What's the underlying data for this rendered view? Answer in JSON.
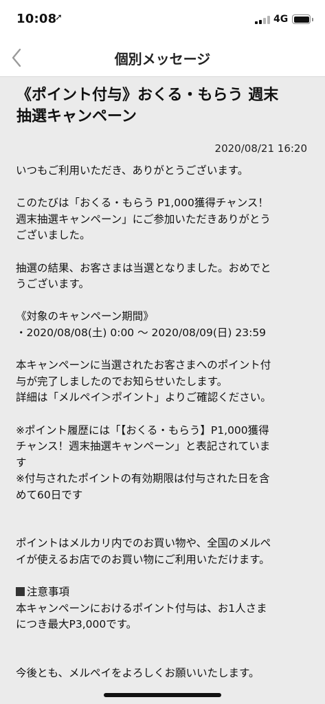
{
  "status_bar": {
    "time": "10:08",
    "location_arrow": "➚",
    "network": "4G",
    "signal_bars_active": 2,
    "signal_bars_total": 4,
    "battery_level": 1.0
  },
  "nav": {
    "title": "個別メッセージ",
    "back_icon": "chevron-left-icon"
  },
  "message": {
    "title_line1": "《ポイント付与》おくる・もらう 週末",
    "title_line2": "抽選キャンペーン",
    "date": "2020/08/21 16:20",
    "lines": {
      "l1": "いつもご利用いただき、ありがとうございます。",
      "l2": "このたびは「おくる・もらう P1,000獲得チャンス！",
      "l3": "週末抽選キャンペーン」にご参加いただきありがとう",
      "l4": "ございました。",
      "l5": "抽選の結果、お客さまは当選となりました。おめでと",
      "l6": "うございます。",
      "l7": "《対象のキャンペーン期間》",
      "l8": "・2020/08/08(土) 0:00 〜 2020/08/09(日) 23:59",
      "l9": "本キャンペーンに当選されたお客さまへのポイント付",
      "l10": "与が完了しましたのでお知らせいたします。",
      "l11": "詳細は「メルペイ＞ポイント」よりご確認ください。",
      "l12": "※ポイント履歴には「【おくる・もらう】P1,000獲得",
      "l13": "チャンス！週末抽選キャンペーン」と表記されていま",
      "l14": "す",
      "l15": "※付与されたポイントの有効期限は付与された日を含",
      "l16": "めて60日です",
      "l17": "ポイントはメルカリ内でのお買い物や、全国のメルペ",
      "l18": "イが使えるお店でのお買い物にご利用いただけます。",
      "l19": "注意事項",
      "l20": "本キャンペーンにおけるポイント付与は、お1人さま",
      "l21": "につき最大P3,000です。",
      "l22": "今後とも、メルペイをよろしくお願いいたします。"
    }
  }
}
